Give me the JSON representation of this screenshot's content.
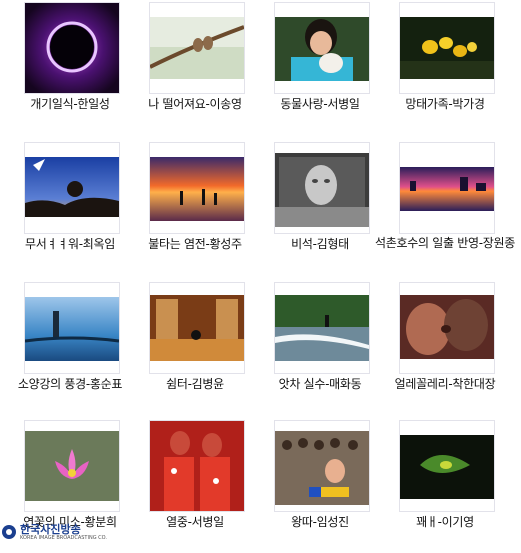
{
  "gallery": {
    "items": [
      {
        "caption": "개기일식-한일성"
      },
      {
        "caption": "나 떨어져요-이송영"
      },
      {
        "caption": "동물사랑-서병일"
      },
      {
        "caption": "망태가족-박가경"
      },
      {
        "caption": "무서ㅕㅕ워-최옥임"
      },
      {
        "caption": "불타는 염전-황성주"
      },
      {
        "caption": "비석-김형태"
      },
      {
        "caption": "석촌호수의 일출 반영-장원종"
      },
      {
        "caption": "소양강의 풍경-홍순표"
      },
      {
        "caption": "쉼터-김병윤"
      },
      {
        "caption": "앗차 실수-매화동"
      },
      {
        "caption": "얼레꼴레리-착한대장"
      },
      {
        "caption": "연꽃의 미소-황분희"
      },
      {
        "caption": "열중-서병일"
      },
      {
        "caption": "왕따-임성진"
      },
      {
        "caption": "꽤ㅐ-이기영"
      }
    ]
  },
  "watermark": {
    "main": "한국사진방송",
    "sub": "KOREA IMAGE BROADCASTING CO."
  }
}
